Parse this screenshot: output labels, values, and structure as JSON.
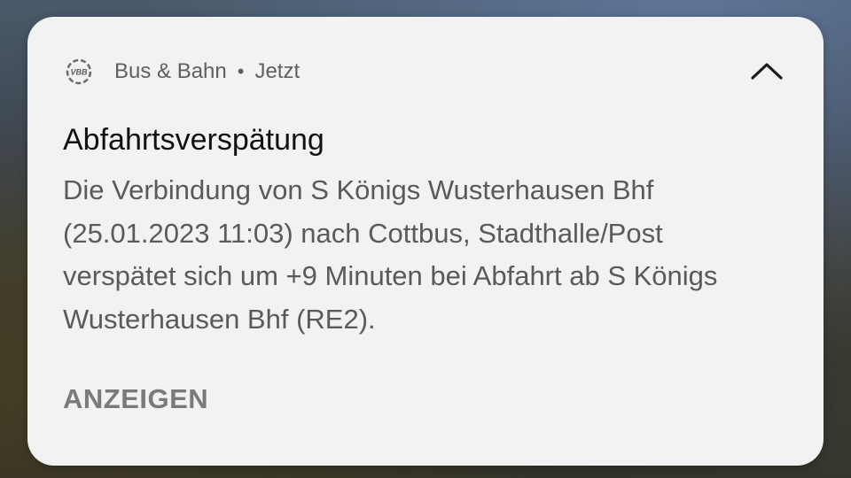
{
  "notification": {
    "app_icon": "vbb-icon",
    "app_icon_text": "VBB",
    "app_name": "Bus & Bahn",
    "separator": "•",
    "time": "Jetzt",
    "collapse_icon": "chevron-up-icon",
    "title": "Abfahrtsverspätung",
    "body": "Die Verbindung von S Königs Wusterhausen Bhf (25.01.2023 11:03) nach Cottbus, Stadthalle/Post verspätet sich um +9 Minuten bei Abfahrt ab S Königs Wusterhausen Bhf (RE2).",
    "action_label": "ANZEIGEN"
  }
}
